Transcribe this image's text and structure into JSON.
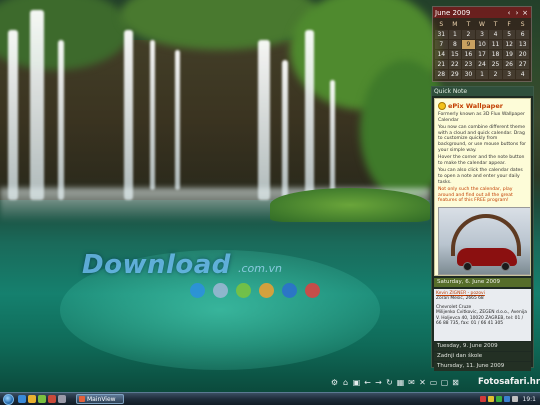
{
  "watermark": {
    "brand": "Download",
    "suffix": ".com.vn"
  },
  "loader_dots_colors": [
    "#2b8fe0",
    "#9fb7d6",
    "#7cc43c",
    "#f0a030",
    "#2b6fd0",
    "#e04040"
  ],
  "calendar": {
    "title": "June 2009",
    "prev_icon": "chevron-left-icon",
    "next_icon": "chevron-right-icon",
    "close_icon": "close-icon",
    "weekdays": [
      "S",
      "M",
      "T",
      "W",
      "T",
      "F",
      "S"
    ],
    "days": [
      "31",
      "1",
      "2",
      "3",
      "4",
      "5",
      "6",
      "7",
      "8",
      "9",
      "10",
      "11",
      "12",
      "13",
      "14",
      "15",
      "16",
      "17",
      "18",
      "19",
      "20",
      "21",
      "22",
      "23",
      "24",
      "25",
      "26",
      "27",
      "28",
      "29",
      "30",
      "1",
      "2",
      "3",
      "4"
    ],
    "today": "9"
  },
  "quick_note": {
    "title": "Quick Note",
    "heading": "ePix Wallpaper",
    "lines": [
      "Formerly known as 3D Flux Wallpaper Calendar",
      "You now can combine different theme with a cloud and quick calendar. Drag to customize quickly from background, or use mouse buttons for your simple way.",
      "Hover the corner and the note button to make the calendar appear.",
      "You can also click the calendar dates to open a note and enter your daily tasks.",
      "Not only such the calendar, play around and find out all the great features of this FREE program!"
    ],
    "image_icon": "eiffel-car-photo"
  },
  "agenda": {
    "day1_header": "Saturday, 6. June 2009",
    "day1_lines": [
      "Kevin ZIGNER - pozovi",
      "Zoran Mesic, 2665 68",
      "Chevrolet Cruze",
      "Milijenko Cvitkovic, ZEGEN d.o.o., Avenija V. Holjevca 40, 10020 ZAGREB, tel: 01 / 66 88 735, fax: 01 / 66 41 305"
    ],
    "day2": "Tuesday, 9. June 2009",
    "day3": "Zadnji dan škole",
    "day4": "Thursday, 11. June 2009"
  },
  "dock": {
    "icons": [
      "settings-icon",
      "home-icon",
      "image-icon",
      "back-icon",
      "forward-icon",
      "refresh-icon",
      "calendar-icon",
      "mail-icon",
      "delete-icon",
      "folder-icon",
      "monitor-icon",
      "close-icon"
    ],
    "brand": "Fotosafari.hr"
  },
  "taskbar": {
    "task_label": "MainView",
    "clock": "19:1"
  }
}
